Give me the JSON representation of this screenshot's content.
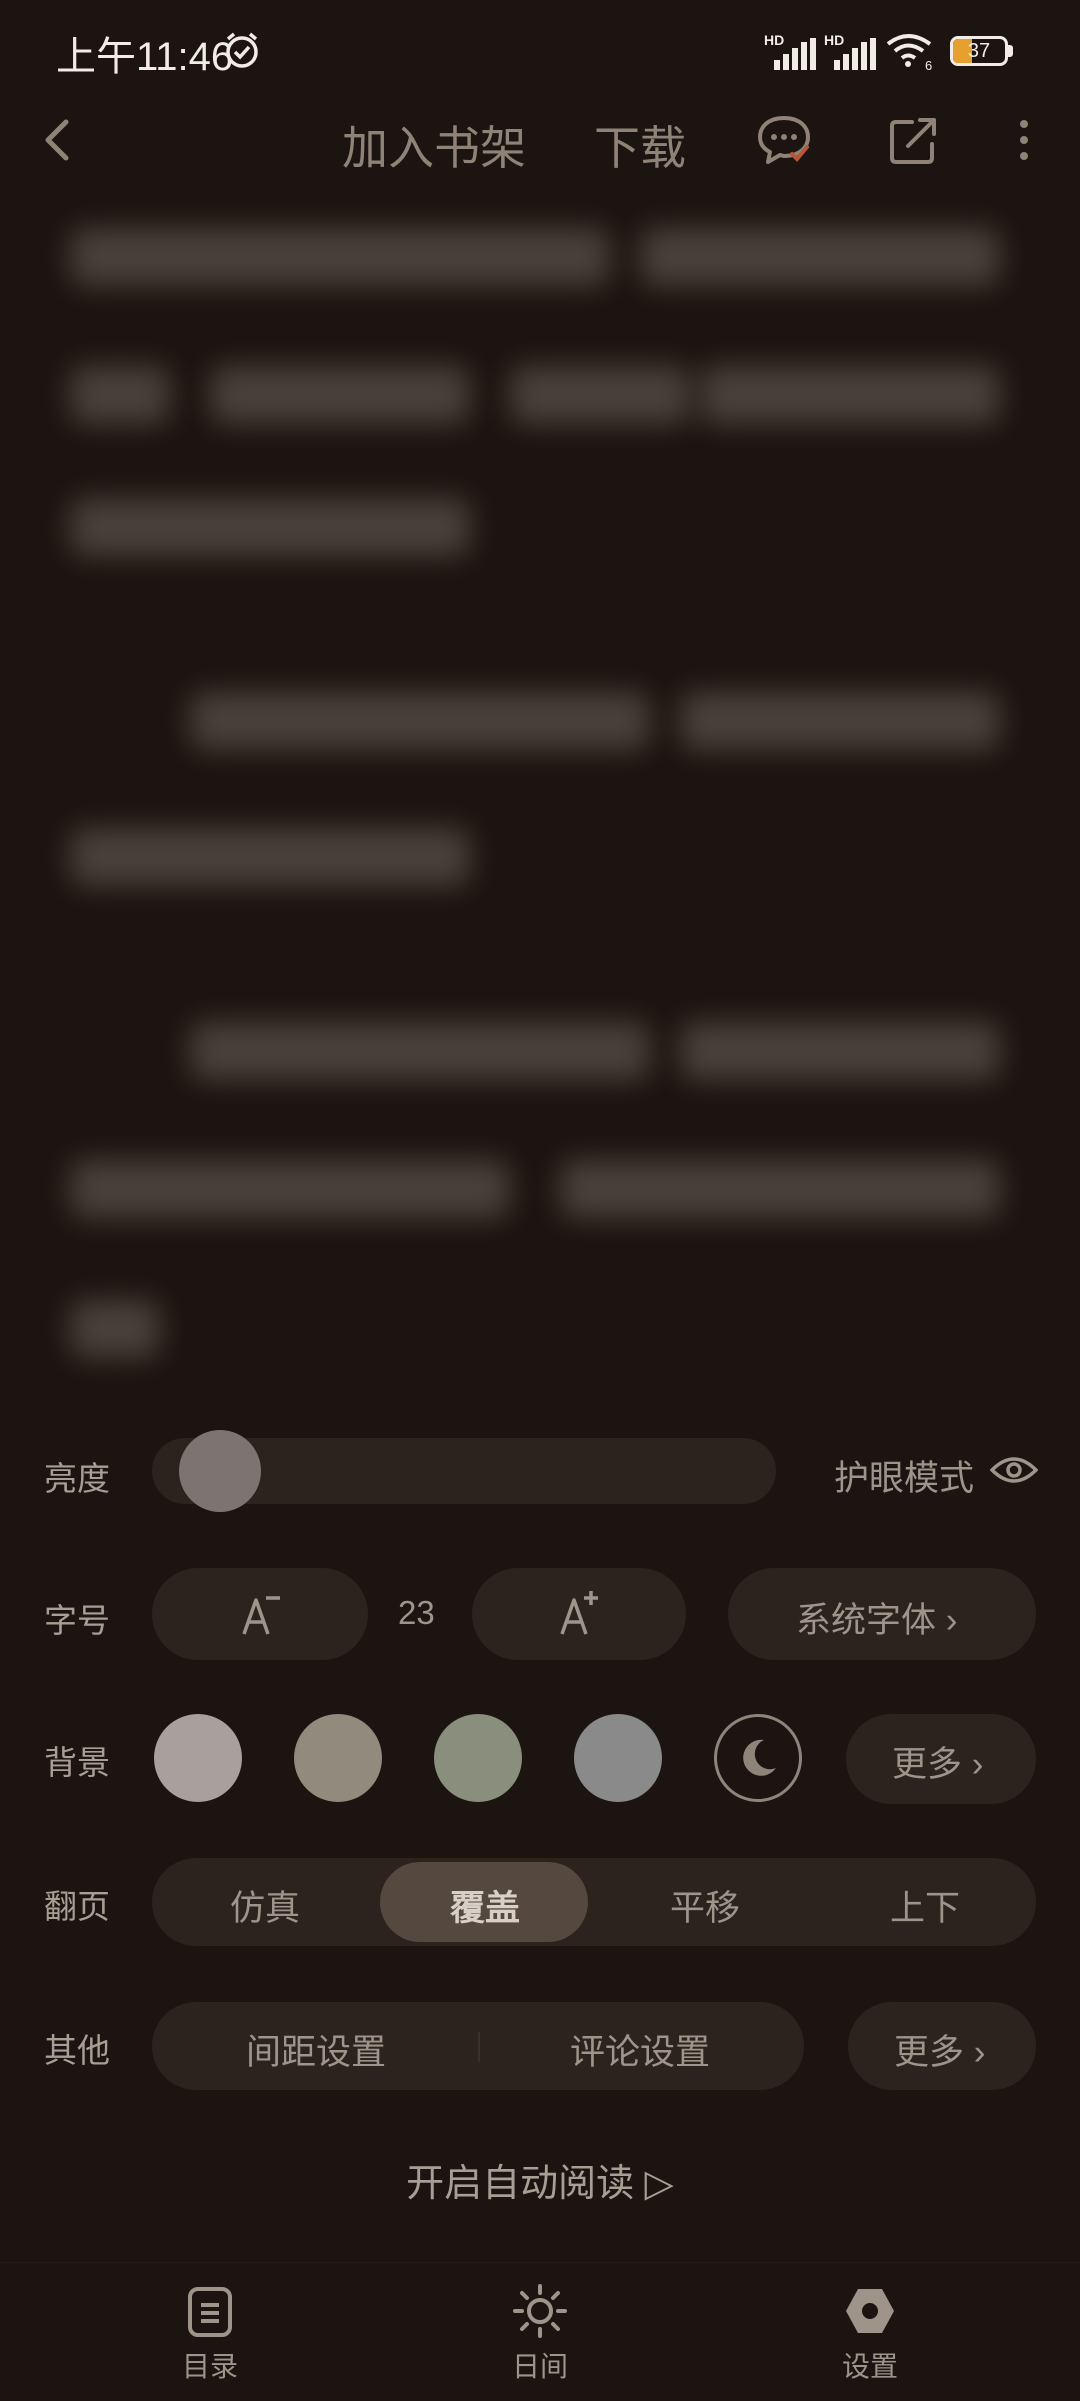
{
  "status_bar": {
    "time": "上午11:46",
    "signal_1_label": "HD",
    "signal_2_label": "HD",
    "wifi_label": "6",
    "battery": "37"
  },
  "top_bar": {
    "add_to_shelf": "加入书架",
    "download": "下载"
  },
  "settings": {
    "brightness_label": "亮度",
    "brightness_level": 0.05,
    "eye_mode_label": "护眼模式",
    "font_label": "字号",
    "font_size": "23",
    "system_font": "系统字体 ›",
    "background_label": "背景",
    "background_colors": [
      "#a8a09c",
      "#928a7c",
      "#8a8e7c",
      "#8a8a8a"
    ],
    "background_more": "更多 ›",
    "page_turn_label": "翻页",
    "page_turn_options": [
      "仿真",
      "覆盖",
      "平移",
      "上下"
    ],
    "page_turn_selected": "覆盖",
    "other_label": "其他",
    "spacing_setting": "间距设置",
    "comment_setting": "评论设置",
    "other_more": "更多 ›",
    "auto_read": "开启自动阅读 ▷"
  },
  "bottom_nav": {
    "toc": "目录",
    "day": "日间",
    "settings": "设置"
  },
  "colors": {
    "background": "#1b1410",
    "pill": "#2c231f",
    "active_segment": "#55483f",
    "battery_fill": "#e6a030"
  }
}
